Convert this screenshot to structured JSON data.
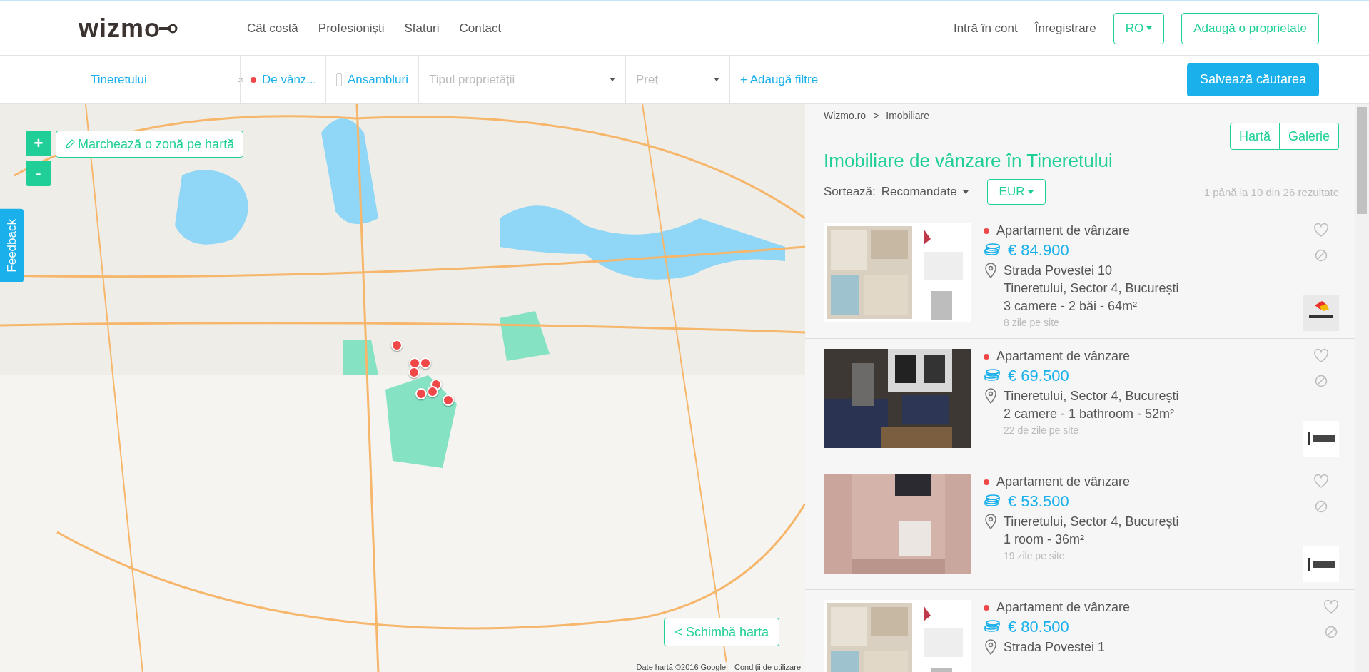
{
  "header": {
    "logo": "wizmo",
    "nav": [
      "Cât costă",
      "Profesioniști",
      "Sfaturi",
      "Contact"
    ],
    "login": "Intră în cont",
    "register": "Înregistrare",
    "language": "RO",
    "add_property": "Adaugă o proprietate"
  },
  "filters": {
    "location": "Tineretului",
    "clear": "×",
    "transaction": "De vânz...",
    "ensembles": {
      "label": "Ansambluri",
      "checked": false
    },
    "property_type": "Tipul proprietății",
    "price": "Preț",
    "add_filters": "+ Adaugă filtre",
    "save": "Salvează căutarea"
  },
  "map": {
    "zoom_in": "+",
    "zoom_out": "-",
    "draw_zone": "Marchează o zonă pe hartă",
    "feedback": "Feedback",
    "change_map": "< Schimbă harta",
    "attribution": [
      "Date hartă ©2016 Google",
      "Condiții de utilizare"
    ]
  },
  "results": {
    "breadcrumb": [
      "Wizmo.ro",
      "Imobiliare"
    ],
    "breadcrumb_separator": ">",
    "views": [
      {
        "label": "Hartă",
        "selected": false
      },
      {
        "label": "Galerie",
        "selected": false
      }
    ],
    "title": "Imobiliare de vânzare în Tineretului",
    "sort_label": "Sortează:",
    "sort_value": "Recomandate",
    "currency": "EUR",
    "count": "1 până la 10 din 26 rezultate",
    "listings": [
      {
        "type": "Apartament de vânzare",
        "price": "€ 84.900",
        "address": [
          "Strada Povestei 10",
          "Tineretului, Sector 4, București"
        ],
        "details": "3 camere - 2 băi - 64m²",
        "age": "8 zile pe site",
        "favorite": false
      },
      {
        "type": "Apartament de vânzare",
        "price": "€ 69.500",
        "address": [
          "Tineretului, Sector 4, București"
        ],
        "details": "2 camere - 1 bathroom - 52m²",
        "age": "22 de zile pe site",
        "favorite": false
      },
      {
        "type": "Apartament de vânzare",
        "price": "€ 53.500",
        "address": [
          "Tineretului, Sector 4, București"
        ],
        "details": "1 room - 36m²",
        "age": "19 zile pe site",
        "favorite": false
      },
      {
        "type": "Apartament de vânzare",
        "price": "€ 80.500",
        "address": [
          "Strada Povestei 1"
        ],
        "favorite": false
      }
    ]
  }
}
